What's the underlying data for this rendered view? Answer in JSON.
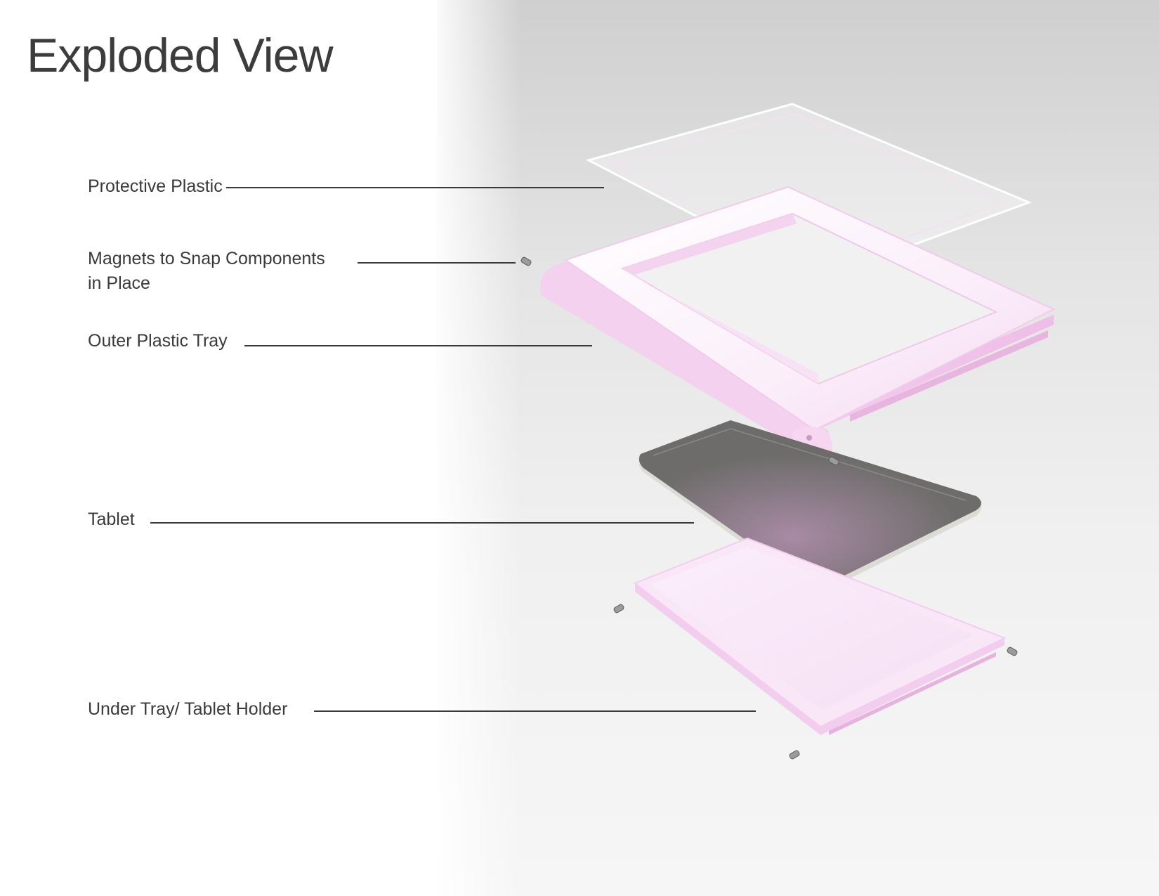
{
  "title": "Exploded View",
  "callouts": [
    {
      "id": "protective-plastic",
      "label": "Protective Plastic"
    },
    {
      "id": "magnets",
      "label_line1": "Magnets to Snap Components",
      "label_line2": "in Place"
    },
    {
      "id": "outer-tray",
      "label": "Outer Plastic Tray"
    },
    {
      "id": "tablet",
      "label": "Tablet"
    },
    {
      "id": "under-tray",
      "label": "Under Tray/ Tablet Holder"
    }
  ],
  "colors": {
    "tray_pink": "#f3c8ec",
    "tray_highlight": "#fbeefa",
    "tablet_gray": "#6d6c6a",
    "text": "#3a3a3a"
  }
}
